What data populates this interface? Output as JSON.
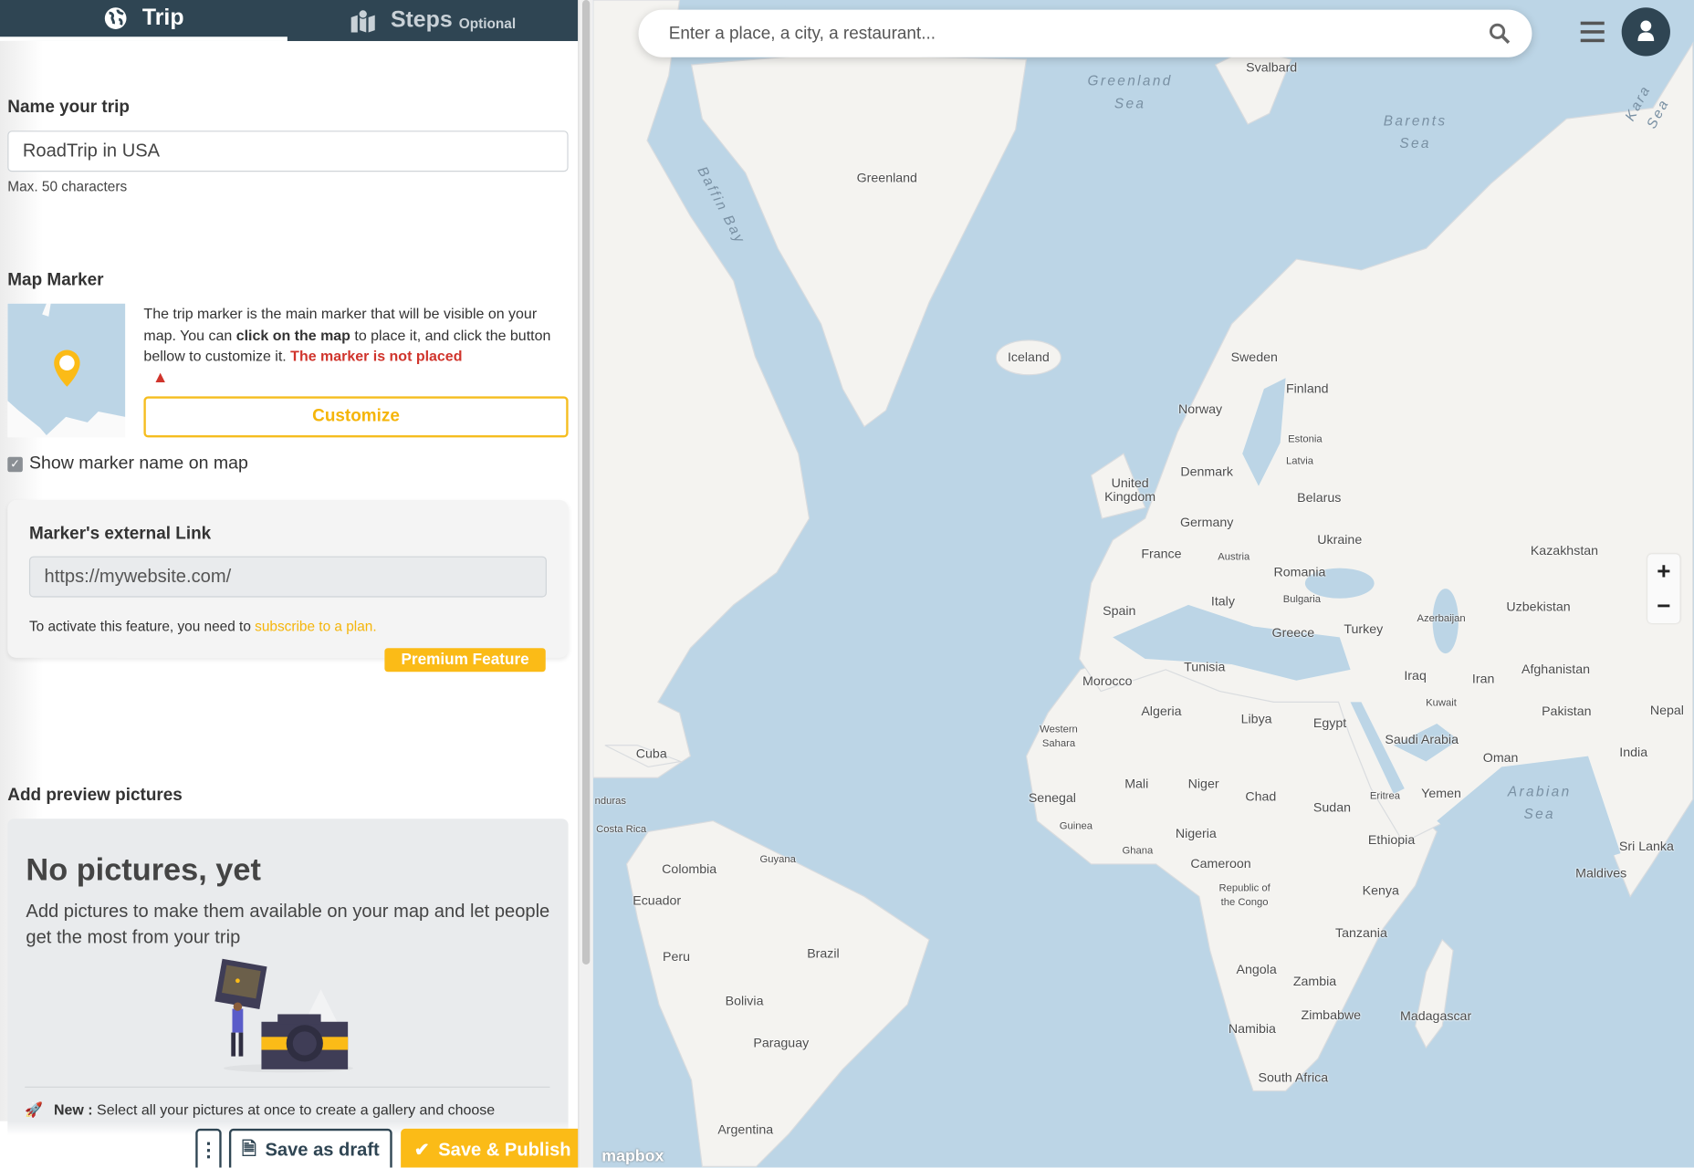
{
  "tabs": [
    {
      "label": "Trip",
      "icon": "globe-icon",
      "active": true
    },
    {
      "label": "Steps",
      "sub": "Optional",
      "icon": "map-marker-icon"
    }
  ],
  "trip_name": {
    "label": "Name your trip",
    "value": "RoadTrip in USA",
    "hint": "Max. 50 characters"
  },
  "map_marker": {
    "title": "Map Marker",
    "text_1": "The trip marker is the main marker that will be visible on your map. You can ",
    "text_bold": "click on the map",
    "text_2": " to place it, and click the button bellow to customize it. ",
    "warning": "The marker is not placed",
    "customize_label": "Customize",
    "show_name_label": "Show marker name on map",
    "show_name_checked": true
  },
  "external_link": {
    "title": "Marker's external Link",
    "value": "https://mywebsite.com/",
    "note": "To activate this feature, you need to ",
    "link": "subscribe to a plan.",
    "badge": "Premium Feature"
  },
  "pictures": {
    "title": "Add preview pictures",
    "heading": "No pictures, yet",
    "text": "Add pictures to make them available on your map and let people get the most from your trip",
    "new_label": "New :",
    "new_text": " Select all your pictures at once to create a gallery and choose"
  },
  "actions": {
    "more": "⋮",
    "draft": "Save as draft",
    "publish": "Save & Publish"
  },
  "map": {
    "search_placeholder": "Enter a place, a city, a restaurant...",
    "zoom_in": "+",
    "zoom_out": "−",
    "attribution": "mapbox",
    "labels": [
      "Greenland Sea",
      "Svalbard",
      "Barents Sea",
      "Kara Sea",
      "Greenland",
      "Baffin Bay",
      "Iceland",
      "Sweden",
      "Finland",
      "Norway",
      "Estonia",
      "Latvia",
      "Denmark",
      "United Kingdom",
      "Belarus",
      "Germany",
      "Ukraine",
      "France",
      "Austria",
      "Kazakhstan",
      "Romania",
      "Bulgaria",
      "Italy",
      "Spain",
      "Uzbekistan",
      "Azerbaijan",
      "Greece",
      "Turkey",
      "Tunisia",
      "Afghanistan",
      "Iraq",
      "Iran",
      "Morocco",
      "Kuwait",
      "Algeria",
      "Libya",
      "Egypt",
      "Pakistan",
      "Nepal",
      "Saudi Arabia",
      "Western Sahara",
      "Cuba",
      "Oman",
      "India",
      "Arabian Sea",
      "Mali",
      "Niger",
      "Chad",
      "Senegal",
      "Eritrea",
      "Yemen",
      "Sudan",
      "nduras",
      "Guinea",
      "Costa Rica",
      "Nigeria",
      "Ethiopia",
      "Sri Lanka",
      "Ghana",
      "Cameroon",
      "Guyana",
      "Colombia",
      "Maldives",
      "Republic of the Congo",
      "Kenya",
      "Ecuador",
      "Tanzania",
      "Brazil",
      "Peru",
      "Angola",
      "Zambia",
      "Bolivia",
      "Zimbabwe",
      "Madagascar",
      "Namibia",
      "Paraguay",
      "South Africa",
      "Argentina"
    ]
  },
  "colors": {
    "header": "#2f4553",
    "accent": "#fbbb17",
    "warning": "#d0342c",
    "water": "#bcd5e6",
    "land": "#f4f3f0"
  }
}
